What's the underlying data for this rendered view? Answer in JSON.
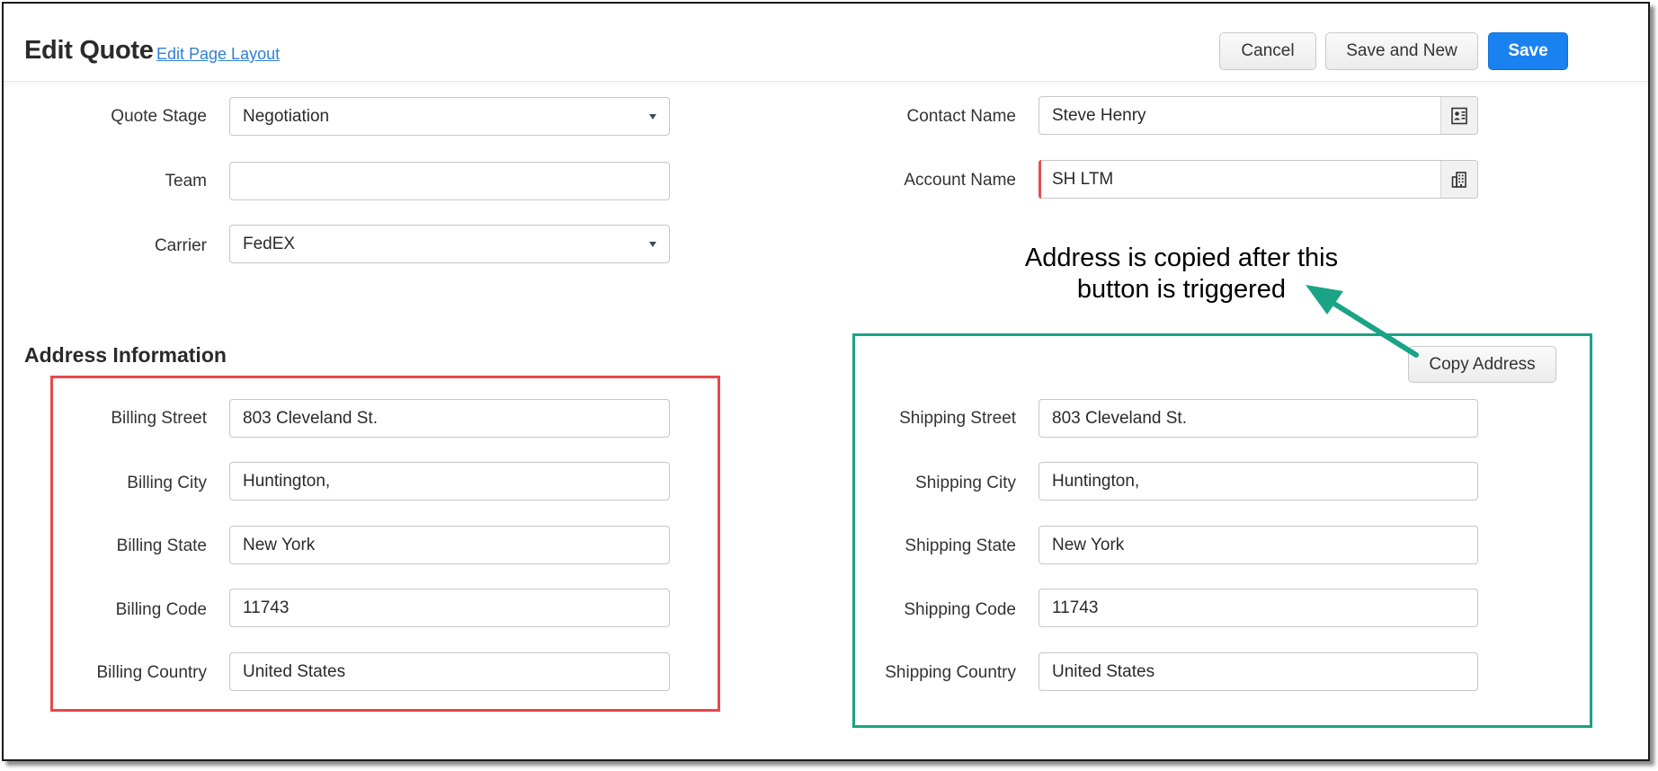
{
  "header": {
    "title": "Edit Quote",
    "edit_layout_link": "Edit Page Layout",
    "buttons": {
      "cancel": "Cancel",
      "save_and_new": "Save and New",
      "save": "Save"
    }
  },
  "quote_fields": {
    "quote_stage": {
      "label": "Quote Stage",
      "value": "Negotiation"
    },
    "team": {
      "label": "Team",
      "value": ""
    },
    "carrier": {
      "label": "Carrier",
      "value": "FedEX"
    },
    "contact_name": {
      "label": "Contact Name",
      "value": "Steve Henry"
    },
    "account_name": {
      "label": "Account Name",
      "value": "SH LTM"
    }
  },
  "address_section": {
    "title": "Address Information",
    "copy_address_button": "Copy Address",
    "billing": {
      "street": {
        "label": "Billing Street",
        "value": "803 Cleveland St."
      },
      "city": {
        "label": "Billing City",
        "value": "Huntington,"
      },
      "state": {
        "label": "Billing State",
        "value": "New York"
      },
      "code": {
        "label": "Billing Code",
        "value": "11743"
      },
      "country": {
        "label": "Billing Country",
        "value": "United States"
      }
    },
    "shipping": {
      "street": {
        "label": "Shipping Street",
        "value": "803 Cleveland St."
      },
      "city": {
        "label": "Shipping City",
        "value": "Huntington,"
      },
      "state": {
        "label": "Shipping State",
        "value": "New York"
      },
      "code": {
        "label": "Shipping Code",
        "value": "11743"
      },
      "country": {
        "label": "Shipping Country",
        "value": "United States"
      }
    }
  },
  "annotation": {
    "line1": "Address is copied after this",
    "line2": "button is triggered"
  },
  "icons": {
    "contact_lookup": "contact-card-icon",
    "account_lookup": "building-icon",
    "dropdown": "caret-down-icon"
  },
  "colors": {
    "primary_button": "#1a82f0",
    "link": "#2f80d6",
    "billing_highlight": "#e8474a",
    "shipping_highlight": "#1aa386",
    "required_marker": "#e05050"
  }
}
